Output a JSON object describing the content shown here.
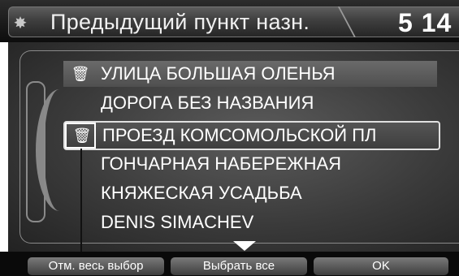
{
  "header": {
    "icon": "gear-icon",
    "title": "Предыдущий пункт назн.",
    "counter": "5 14"
  },
  "list": {
    "items": [
      {
        "label": "УЛИЦА БОЛЬШАЯ ОЛЕНЬЯ",
        "icon": "trash-icon",
        "state": "highlighted"
      },
      {
        "label": "ДОРОГА БЕЗ НАЗВАНИЯ",
        "icon": "",
        "state": "normal"
      },
      {
        "label": "ПРОЕЗД КОМСОМОЛЬСКОЙ ПЛ",
        "icon": "trash-icon",
        "state": "selected"
      },
      {
        "label": "ГОНЧАРНАЯ НАБЕРЕЖНАЯ",
        "icon": "",
        "state": "normal"
      },
      {
        "label": "КНЯЖЕСКАЯ УСАДЬБА",
        "icon": "",
        "state": "normal"
      },
      {
        "label": "DENIS SIMACHEV",
        "icon": "",
        "state": "normal"
      }
    ]
  },
  "footer": {
    "deselect_all": "Отм. весь выбор",
    "select_all": "Выбрать все",
    "ok": "OK"
  }
}
